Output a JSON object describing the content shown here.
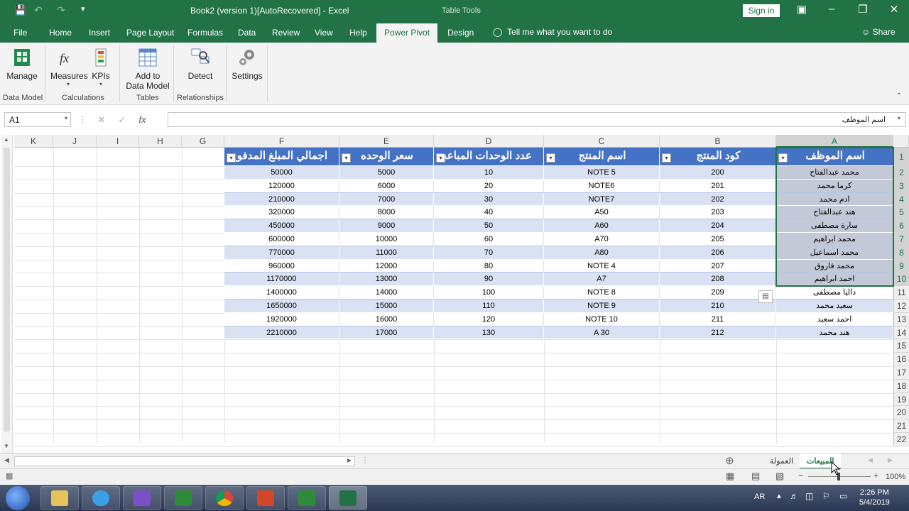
{
  "titlebar": {
    "title": "Book2 (version 1)[AutoRecovered]  -  Excel",
    "table_tools": "Table Tools",
    "signin": "Sign in"
  },
  "menu": {
    "tabs": [
      "File",
      "Home",
      "Insert",
      "Page Layout",
      "Formulas",
      "Data",
      "Review",
      "View",
      "Help",
      "Power Pivot",
      "Design"
    ],
    "active": "Power Pivot",
    "tell_me": "Tell me what you want to do",
    "share": "Share"
  },
  "ribbon": {
    "buttons": [
      "Manage",
      "Measures",
      "KPIs",
      "Add to",
      "Data Model",
      "Detect",
      "Settings"
    ],
    "groups": [
      "Data Model",
      "Calculations",
      "Tables",
      "Relationships"
    ]
  },
  "formula_bar": {
    "name_box": "A1",
    "content": "اسم الموظف"
  },
  "columns": [
    "K",
    "J",
    "I",
    "H",
    "G",
    "F",
    "E",
    "D",
    "C",
    "B",
    "A"
  ],
  "rows": [
    "1",
    "2",
    "3",
    "4",
    "5",
    "6",
    "7",
    "8",
    "9",
    "10",
    "11",
    "12",
    "13",
    "14",
    "15",
    "16",
    "17",
    "18",
    "19",
    "20",
    "21",
    "22"
  ],
  "table": {
    "headers": [
      "اسم الموظف",
      "كود المنتج",
      "اسم المنتج",
      "عدد الوحدات المباعه",
      "سعر الوحده",
      "اجمالي المبلغ المدفوع"
    ],
    "rows": [
      [
        "محمد عبدالفتاح",
        "200",
        "NOTE 5",
        "10",
        "5000",
        "50000"
      ],
      [
        "كرما محمد",
        "201",
        "NOTE6",
        "20",
        "6000",
        "120000"
      ],
      [
        "ادم محمد",
        "202",
        "NOTE7",
        "30",
        "7000",
        "210000"
      ],
      [
        "هند عبدالفتاح",
        "203",
        "A50",
        "40",
        "8000",
        "320000"
      ],
      [
        "سارة مصطفى",
        "204",
        "A60",
        "50",
        "9000",
        "450000"
      ],
      [
        "محمد ابراهيم",
        "205",
        "A70",
        "60",
        "10000",
        "600000"
      ],
      [
        "محمد اسماعيل",
        "206",
        "A80",
        "70",
        "11000",
        "770000"
      ],
      [
        "محمد فاروق",
        "207",
        "NOTE 4",
        "80",
        "12000",
        "960000"
      ],
      [
        "احمد ابراهيم",
        "208",
        "A7",
        "90",
        "13000",
        "1170000"
      ],
      [
        "داليا مصطفى",
        "209",
        "NOTE 8",
        "100",
        "14000",
        "1400000"
      ],
      [
        "سعيد محمد",
        "210",
        "NOTE 9",
        "110",
        "15000",
        "1650000"
      ],
      [
        "احمد سعيد",
        "211",
        "NOTE 10",
        "120",
        "16000",
        "1920000"
      ],
      [
        "هند محمد",
        "212",
        "A 30",
        "130",
        "17000",
        "2210000"
      ]
    ]
  },
  "sheets": {
    "tabs": [
      "العمولة",
      "المبيعات"
    ],
    "active": "المبيعات"
  },
  "status": {
    "zoom": "100%"
  },
  "taskbar": {
    "lang": "AR",
    "time": "2:26 PM",
    "date": "5/4/2019"
  },
  "colors": {
    "excel_green": "#217346",
    "table_header": "#4472c4",
    "table_band": "#d9e1f2"
  }
}
